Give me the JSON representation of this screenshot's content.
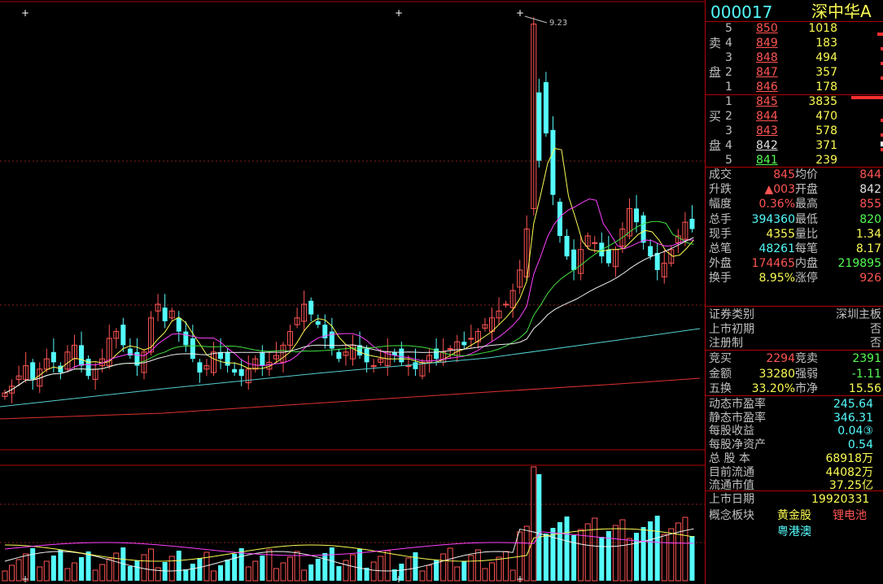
{
  "header": {
    "code": "000017",
    "name": "深中华A"
  },
  "sell": {
    "label_1": "卖",
    "label_2": "盘",
    "levels": [
      {
        "no": "5",
        "price": "850",
        "vol": "1018"
      },
      {
        "no": "4",
        "price": "849",
        "vol": "183"
      },
      {
        "no": "3",
        "price": "848",
        "vol": "494"
      },
      {
        "no": "2",
        "price": "847",
        "vol": "357"
      },
      {
        "no": "1",
        "price": "846",
        "vol": "178"
      }
    ]
  },
  "buy": {
    "label_1": "买",
    "label_2": "盘",
    "levels": [
      {
        "no": "1",
        "price": "845",
        "vol": "3835"
      },
      {
        "no": "2",
        "price": "844",
        "vol": "470"
      },
      {
        "no": "3",
        "price": "843",
        "vol": "578"
      },
      {
        "no": "4",
        "price": "842",
        "vol": "371"
      },
      {
        "no": "5",
        "price": "841",
        "vol": "239"
      }
    ]
  },
  "stats": [
    {
      "l1": "成交",
      "v1": "845",
      "c1": "red",
      "l2": "均价",
      "v2": "844",
      "c2": "red"
    },
    {
      "l1": "升跌",
      "v1": "▲003",
      "c1": "red",
      "l2": "开盘",
      "v2": "842",
      "c2": "white"
    },
    {
      "l1": "幅度",
      "v1": "0.36%",
      "c1": "red",
      "l2": "最高",
      "v2": "855",
      "c2": "red"
    },
    {
      "l1": "总手",
      "v1": "394360",
      "c1": "cyan",
      "l2": "最低",
      "v2": "820",
      "c2": "green"
    },
    {
      "l1": "现手",
      "v1": "4355",
      "c1": "yellow",
      "l2": "量比",
      "v2": "1.34",
      "c2": "yellow"
    },
    {
      "l1": "总笔",
      "v1": "48261",
      "c1": "cyan",
      "l2": "每笔",
      "v2": "8.17",
      "c2": "yellow"
    },
    {
      "l1": "外盘",
      "v1": "174465",
      "c1": "red",
      "l2": "内盘",
      "v2": "219895",
      "c2": "green"
    },
    {
      "l1": "换手",
      "v1": "8.95%",
      "c1": "yellow",
      "l2": "涨停",
      "v2": "926",
      "c2": "red"
    }
  ],
  "info": [
    {
      "label": "证券类别",
      "value": "深圳主板"
    },
    {
      "label": "上市初期",
      "value": "否"
    },
    {
      "label": "注册制",
      "value": "否"
    }
  ],
  "auction": [
    {
      "l1": "竞买",
      "v1": "2294",
      "c1": "red",
      "l2": "竞卖",
      "v2": "2391",
      "c2": "green"
    },
    {
      "l1": "金额",
      "v1": "33280",
      "c1": "yellow",
      "l2": "强弱",
      "v2": "-1.11",
      "c2": "green"
    },
    {
      "l1": "五换",
      "v1": "33.20%",
      "c1": "yellow",
      "l2": "市净",
      "v2": "15.56",
      "c2": "yellow"
    }
  ],
  "fundamentals": [
    {
      "label": "动态市盈率",
      "value": "245.64",
      "color": "cyan"
    },
    {
      "label": "静态市盈率",
      "value": "346.31",
      "color": "cyan"
    },
    {
      "label": "每股收益",
      "value": "0.04③",
      "color": "cyan"
    },
    {
      "label": "每股净资产",
      "value": "0.54",
      "color": "cyan"
    },
    {
      "label": "总 股 本",
      "value": "68918万",
      "color": "yellow"
    },
    {
      "label": "目前流通",
      "value": "44082万",
      "color": "yellow"
    },
    {
      "label": "流通市值",
      "value": "37.25亿",
      "color": "yellow"
    }
  ],
  "listing": {
    "label": "上市日期",
    "value": "19920331"
  },
  "concept": {
    "label": "概念板块",
    "tags": [
      "黄金股",
      "锂电池",
      "粤港澳"
    ]
  },
  "chart": {
    "peak_label": "9.23"
  },
  "colors": {
    "up": "#ff5454",
    "down": "#54fcfc",
    "ma5": "#f0f0f0",
    "ma10": "#fcfc54",
    "ma20": "#ff40ff",
    "ma30": "#40e040",
    "ma60": "#54d0d0",
    "ma250": "#e03030"
  }
}
